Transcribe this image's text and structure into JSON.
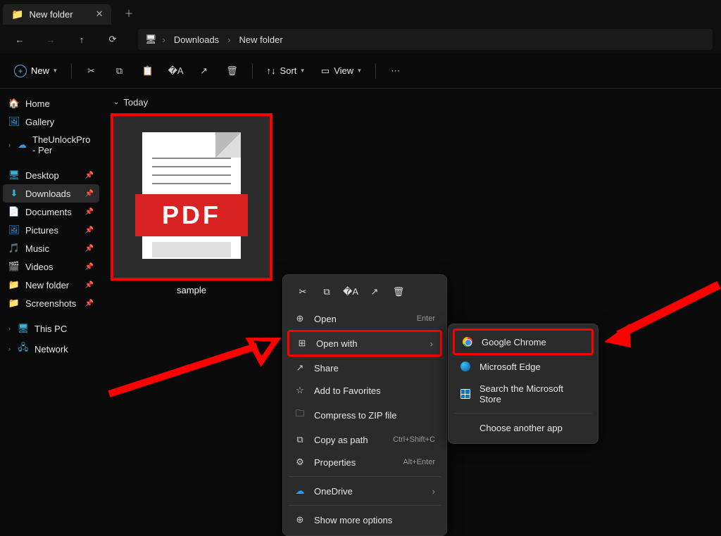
{
  "tab": {
    "title": "New folder"
  },
  "breadcrumb": {
    "root_icon": "monitor",
    "items": [
      "Downloads",
      "New folder"
    ]
  },
  "toolbar": {
    "new_label": "New",
    "sort_label": "Sort",
    "view_label": "View"
  },
  "sidebar": {
    "quick": [
      {
        "icon": "🏠",
        "label": "Home"
      },
      {
        "icon": "🖼",
        "label": "Gallery",
        "color": "#3a9bdc"
      },
      {
        "icon": "☁",
        "label": "TheUnlockPro - Per",
        "expand": true,
        "color": "#3a9bdc"
      }
    ],
    "pinned": [
      {
        "icon": "🖥",
        "label": "Desktop",
        "color": "#3ab0d4"
      },
      {
        "icon": "⬇",
        "label": "Downloads",
        "active": true,
        "color": "#3ab0d4"
      },
      {
        "icon": "📄",
        "label": "Documents",
        "color": "#3ab0d4"
      },
      {
        "icon": "🖼",
        "label": "Pictures",
        "color": "#3a9bdc"
      },
      {
        "icon": "🎵",
        "label": "Music",
        "color": "#e0733a"
      },
      {
        "icon": "🎬",
        "label": "Videos",
        "color": "#8a5cd6"
      },
      {
        "icon": "📁",
        "label": "New folder",
        "color": "#ffd968"
      },
      {
        "icon": "📁",
        "label": "Screenshots",
        "color": "#ffd968"
      }
    ],
    "drives": [
      {
        "icon": "🖥",
        "label": "This PC",
        "expand": true,
        "color": "#3ab0d4"
      },
      {
        "icon": "🖧",
        "label": "Network",
        "expand": true,
        "color": "#3ab0d4"
      }
    ]
  },
  "group_label": "Today",
  "file": {
    "name": "sample",
    "badge": "PDF"
  },
  "context_menu": {
    "items": [
      {
        "icon": "⊕",
        "label": "Open",
        "shortcut": "Enter"
      },
      {
        "icon": "⊞",
        "label": "Open with",
        "submenu": true,
        "highlight": true
      },
      {
        "icon": "↗",
        "label": "Share"
      },
      {
        "icon": "☆",
        "label": "Add to Favorites"
      },
      {
        "icon": "🗀",
        "label": "Compress to ZIP file"
      },
      {
        "icon": "⧉",
        "label": "Copy as path",
        "shortcut": "Ctrl+Shift+C"
      },
      {
        "icon": "⚙",
        "label": "Properties",
        "shortcut": "Alt+Enter"
      }
    ],
    "onedrive_label": "OneDrive",
    "more_label": "Show more options"
  },
  "submenu": {
    "items": [
      {
        "type": "chrome",
        "label": "Google Chrome",
        "highlight": true
      },
      {
        "type": "edge",
        "label": "Microsoft Edge"
      },
      {
        "type": "store",
        "label": "Search the Microsoft Store"
      }
    ],
    "choose_label": "Choose another app"
  }
}
